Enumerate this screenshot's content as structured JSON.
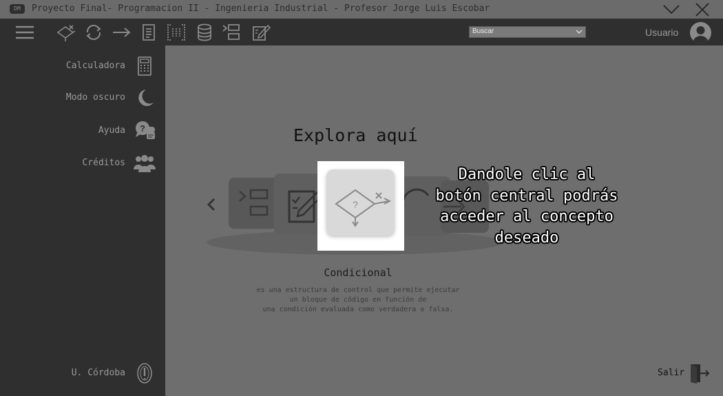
{
  "window": {
    "title": "Proyecto Final- Programacion II - Ingenieria Industrial - Profesor Jorge Luis Escobar",
    "app_icon_text": "DM"
  },
  "toolbar": {
    "menu_icon": "hamburger-menu-icon",
    "tools": [
      "conditional-icon",
      "loop-icon",
      "arrow-icon",
      "document-icon",
      "array-icon",
      "database-icon",
      "list-icon",
      "edit-icon"
    ],
    "search": {
      "value": "Buscar"
    },
    "user_label": "Usuario"
  },
  "sidebar": {
    "items": [
      {
        "label": "Calculadora",
        "icon": "calculator-icon"
      },
      {
        "label": "Modo oscuro",
        "icon": "moon-icon"
      },
      {
        "label": "Ayuda",
        "icon": "help-chat-icon"
      },
      {
        "label": "Créditos",
        "icon": "people-icon"
      }
    ],
    "footer": {
      "label": "U. Córdoba",
      "icon": "university-logo-icon"
    }
  },
  "main": {
    "heading": "Explora aquí",
    "carousel": {
      "items": [
        "list-icon",
        "edit-icon",
        "conditional-icon",
        "loop-icon",
        "arrow-icon"
      ],
      "active": "conditional-icon"
    },
    "concept": {
      "title": "Condicional",
      "description": [
        "es una estructura de control que permite ejecutar",
        "un bloque de código en función de",
        "una condición evaluada como verdadera o falsa."
      ]
    },
    "tooltip": [
      "Dandole clic al",
      "botón central podrás",
      "acceder al concepto",
      "deseado"
    ],
    "exit": {
      "label": "Salir",
      "icon": "exit-door-icon"
    }
  },
  "colors": {
    "sidebar_bg": "#2f2f2f",
    "main_bg": "#6e6e6e",
    "highlight": "#ffffff",
    "icon_gray": "#8a8a8a"
  }
}
